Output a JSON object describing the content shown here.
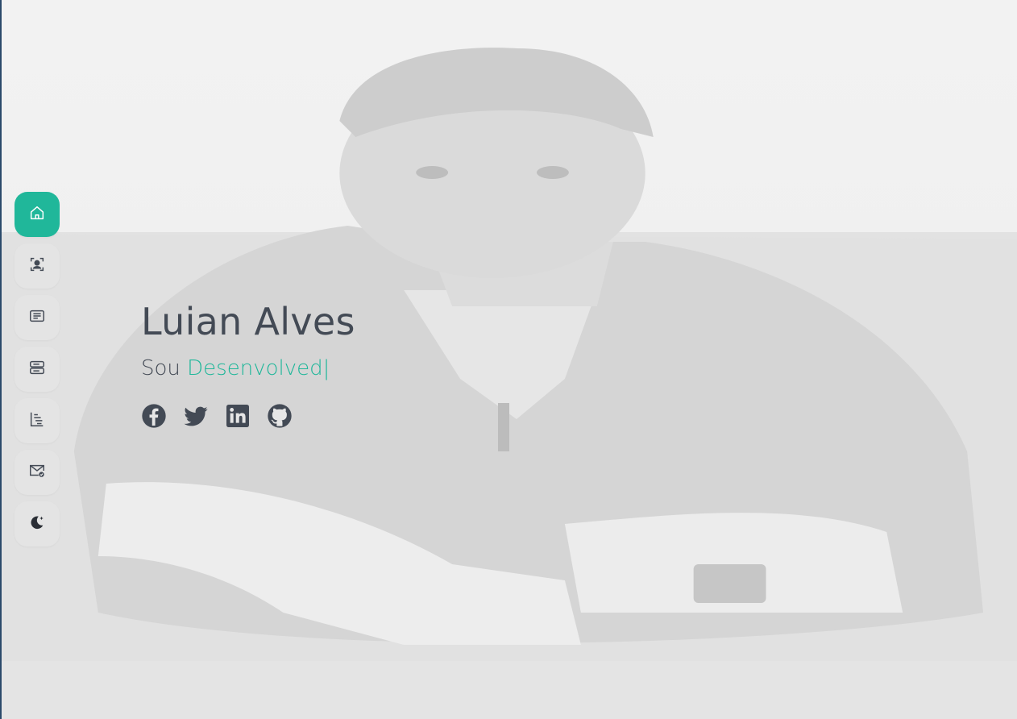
{
  "hero": {
    "name": "Luian Alves",
    "prefix": "Sou",
    "typed_text": "Desenvolved",
    "cursor": "|"
  },
  "sidebar": {
    "items": [
      {
        "icon": "home-icon",
        "active": true
      },
      {
        "icon": "user-icon",
        "active": false
      },
      {
        "icon": "document-icon",
        "active": false
      },
      {
        "icon": "layers-icon",
        "active": false
      },
      {
        "icon": "timeline-icon",
        "active": false
      },
      {
        "icon": "mail-check-icon",
        "active": false
      },
      {
        "icon": "moon-icon",
        "active": false
      }
    ]
  },
  "socials": [
    {
      "icon": "facebook-icon"
    },
    {
      "icon": "twitter-icon"
    },
    {
      "icon": "linkedin-icon"
    },
    {
      "icon": "github-icon"
    }
  ],
  "colors": {
    "accent": "#20b79a",
    "text": "#434a55",
    "nav_bg": "#e4e4e4"
  }
}
